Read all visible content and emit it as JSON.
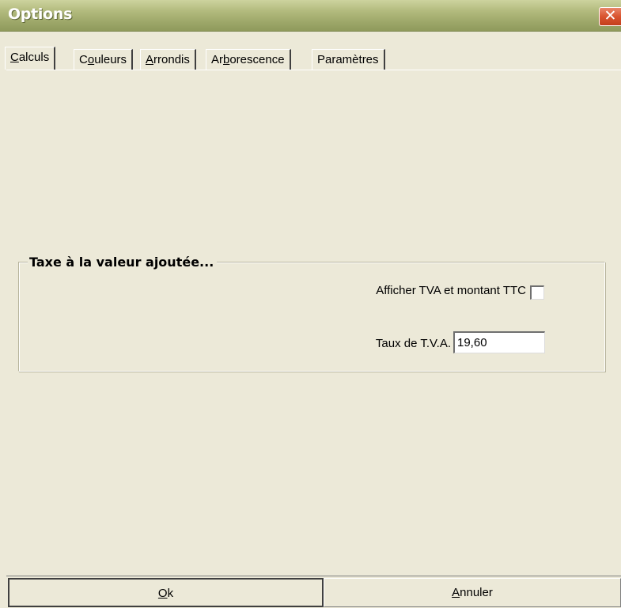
{
  "window": {
    "title": "Options",
    "close_icon": "✕"
  },
  "tabs": [
    {
      "key": "C",
      "rest": "alculs",
      "active": true
    },
    {
      "prefix": "C",
      "key": "o",
      "rest": "uleurs",
      "active": false
    },
    {
      "key": "A",
      "rest": "rrondis",
      "active": false
    },
    {
      "prefix": "Ar",
      "key": "b",
      "rest": "orescence",
      "active": false
    },
    {
      "prefix": "Paramètres",
      "key": "",
      "rest": "",
      "active": false
    }
  ],
  "vat_group": {
    "legend": "Taxe à la valeur ajoutée...",
    "show_vat_label": "Afficher TVA et montant TTC",
    "show_vat_checked": false,
    "rate_label": "Taux de T.V.A.",
    "rate_value": "19,60"
  },
  "buttons": {
    "ok": {
      "key": "O",
      "rest": "k"
    },
    "cancel": {
      "key": "A",
      "rest": "nnuler"
    }
  }
}
